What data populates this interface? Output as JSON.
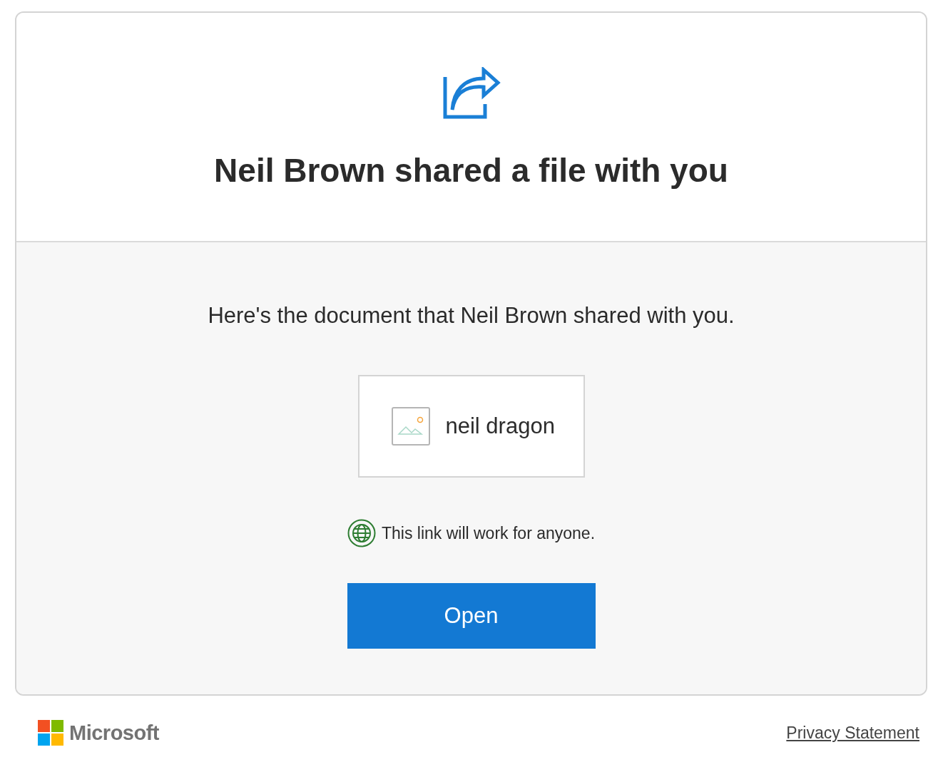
{
  "header": {
    "title": "Neil Brown shared a file with you"
  },
  "body": {
    "message": "Here's the document that Neil Brown shared with you.",
    "file": {
      "name": "neil dragon"
    },
    "link_note": "This link will work for anyone.",
    "button": "Open"
  },
  "footer": {
    "brand": "Microsoft",
    "link": "Privacy Statement"
  }
}
